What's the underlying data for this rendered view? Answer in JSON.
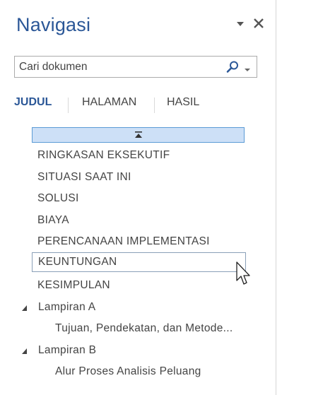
{
  "pane": {
    "title": "Navigasi",
    "dropdown_icon": "triangle-down-icon",
    "close_icon": "close-icon"
  },
  "search": {
    "placeholder": "Cari dokumen",
    "icon": "magnifier-icon"
  },
  "tabs": [
    {
      "label": "JUDUL",
      "active": true
    },
    {
      "label": "HALAMAN",
      "active": false
    },
    {
      "label": "HASIL",
      "active": false
    }
  ],
  "collapse_icon": "collapse-all-icon",
  "headings": [
    {
      "label": "RINGKASAN EKSEKUTIF",
      "level": 1
    },
    {
      "label": "SITUASI SAAT INI",
      "level": 1
    },
    {
      "label": "SOLUSI",
      "level": 1
    },
    {
      "label": "BIAYA",
      "level": 1
    },
    {
      "label": "PERENCANAAN IMPLEMENTASI",
      "level": 1
    },
    {
      "label": "KEUNTUNGAN",
      "level": 1,
      "hovered": true
    },
    {
      "label": "KESIMPULAN",
      "level": 1
    },
    {
      "label": "Lampiran A",
      "level": 1,
      "expanded": true
    },
    {
      "label": "Tujuan, Pendekatan, dan Metode...",
      "level": 2
    },
    {
      "label": "Lampiran B",
      "level": 1,
      "expanded": true
    },
    {
      "label": "Alur Proses Analisis Peluang",
      "level": 2
    }
  ],
  "accent_color": "#2b5797"
}
